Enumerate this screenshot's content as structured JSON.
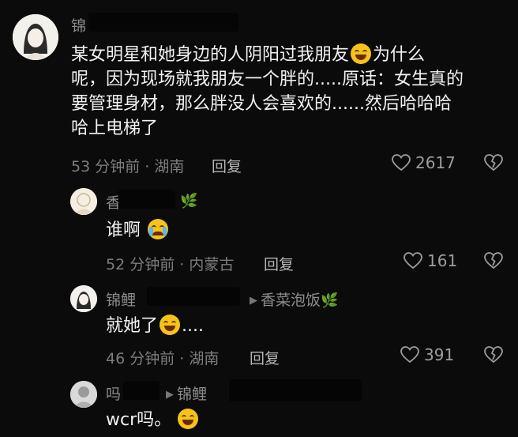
{
  "comments": [
    {
      "name": "锦",
      "text_lines": [
        "某女明星和她身边的人阴阳过我朋友",
        "呢，因为现场就我朋友一个胖的.....原话：女生真的",
        "要管理身材，那么胖没人会喜欢的......然后哈哈哈",
        "哈上电梯了"
      ],
      "after_emoji": "为什么",
      "time_location": "53 分钟前 · 湖南",
      "reply_label": "回复",
      "likes": "2617"
    },
    {
      "name": "香",
      "text": "谁啊",
      "time_location": "52 分钟前 · 内蒙古",
      "reply_label": "回复",
      "likes": "161"
    },
    {
      "name": "锦鲤",
      "reply_to": "香菜泡饭",
      "text": "就她了",
      "text_suffix": "....",
      "time_location": "46 分钟前 · 湖南",
      "reply_label": "回复",
      "likes": "391"
    },
    {
      "name": "吗",
      "reply_to": "锦鲤",
      "text": "wcr吗。"
    }
  ],
  "colors": {
    "background": "#0b0b0b",
    "meta_text": "#7d7d7d",
    "body_text": "#f2f2f2"
  },
  "icons": [
    "heart-outline-icon",
    "broken-heart-icon",
    "reply-arrow-icon",
    "leaf-icon"
  ]
}
